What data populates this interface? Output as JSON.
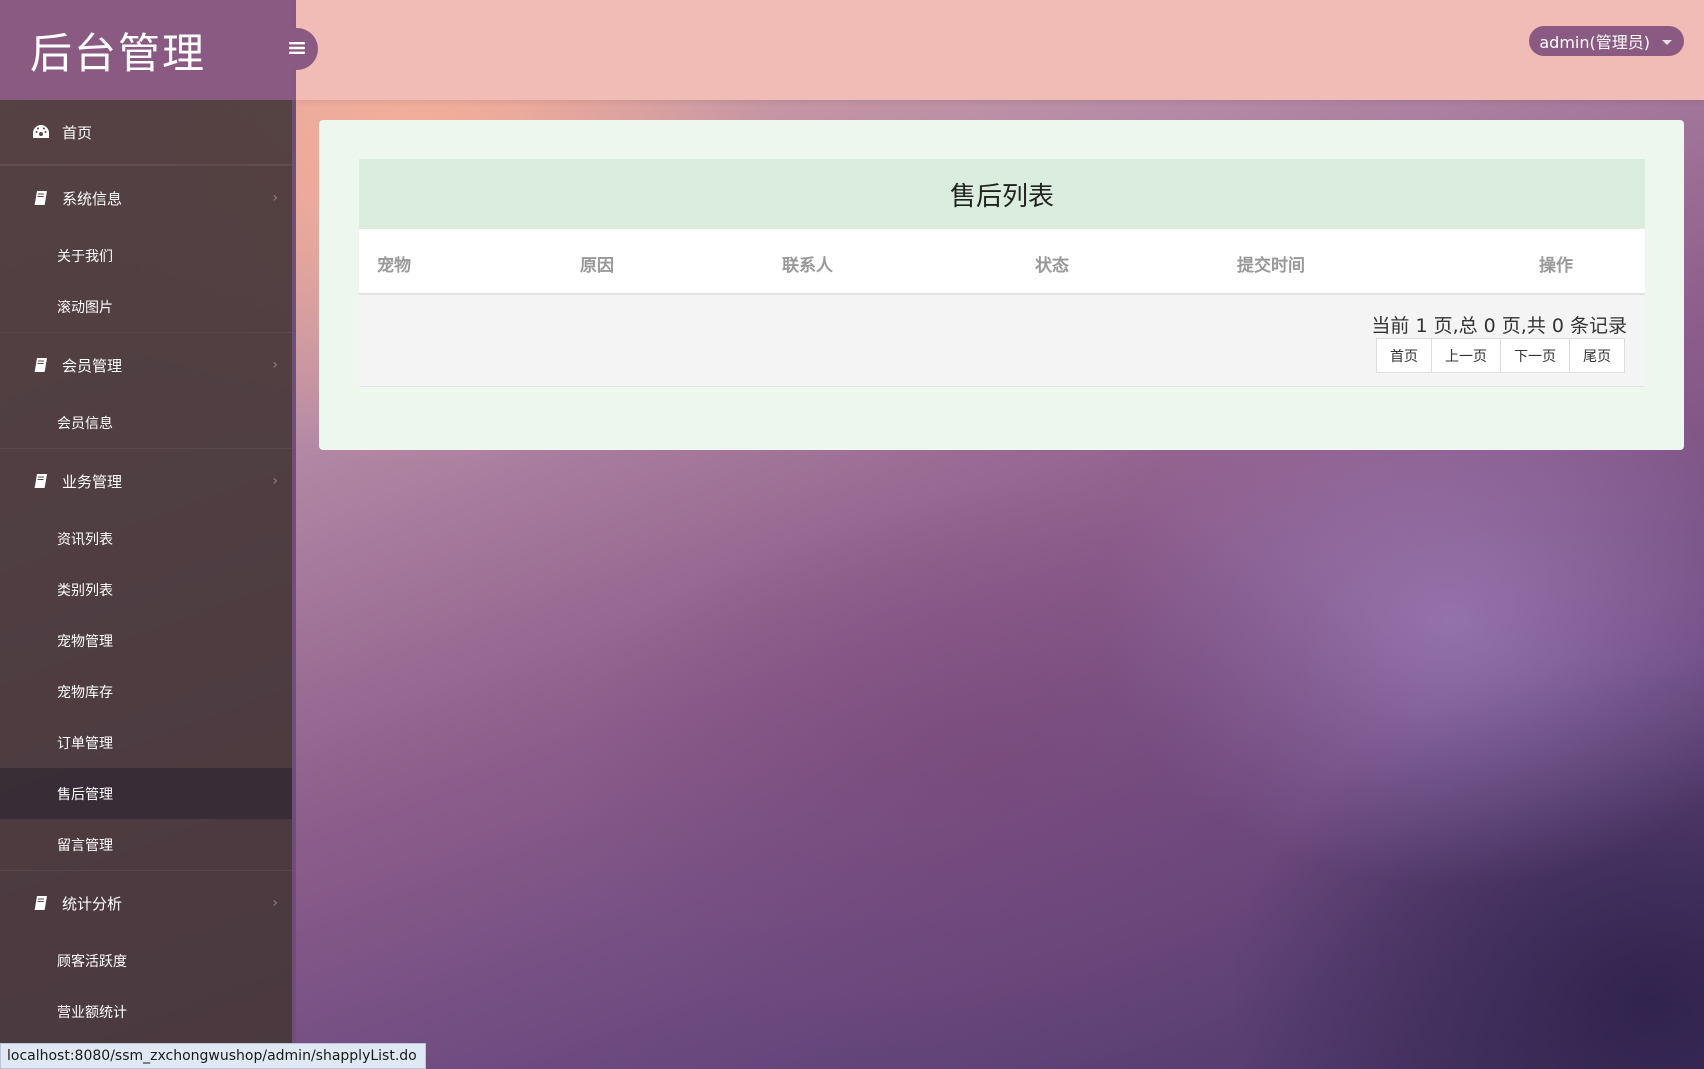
{
  "brand": {
    "title": "后台管理"
  },
  "user": {
    "label": "admin(管理员)"
  },
  "sidebar": {
    "home": "首页",
    "groups": [
      {
        "label": "系统信息",
        "items": [
          "关于我们",
          "滚动图片"
        ]
      },
      {
        "label": "会员管理",
        "items": [
          "会员信息"
        ]
      },
      {
        "label": "业务管理",
        "items": [
          "资讯列表",
          "类别列表",
          "宠物管理",
          "宠物库存",
          "订单管理",
          "售后管理",
          "留言管理"
        ]
      },
      {
        "label": "统计分析",
        "items": [
          "顾客活跃度",
          "营业额统计"
        ]
      }
    ],
    "active_item": "售后管理"
  },
  "main": {
    "title": "售后列表",
    "columns": [
      "宠物",
      "原因",
      "联系人",
      "状态",
      "提交时间",
      "操作"
    ],
    "rows": [],
    "page_info": "当前 1 页,总 0 页,共 0 条记录",
    "pager": {
      "first": "首页",
      "prev": "上一页",
      "next": "下一页",
      "last": "尾页"
    }
  },
  "status_bar": {
    "url": "localhost:8080/ssm_zxchongwushop/admin/shapplyList.do"
  },
  "colors": {
    "sidebar_brand": "#8a5a83",
    "topbar": "#f1bcb5",
    "panel": "#eef7ee",
    "card_header": "#dbeede"
  }
}
